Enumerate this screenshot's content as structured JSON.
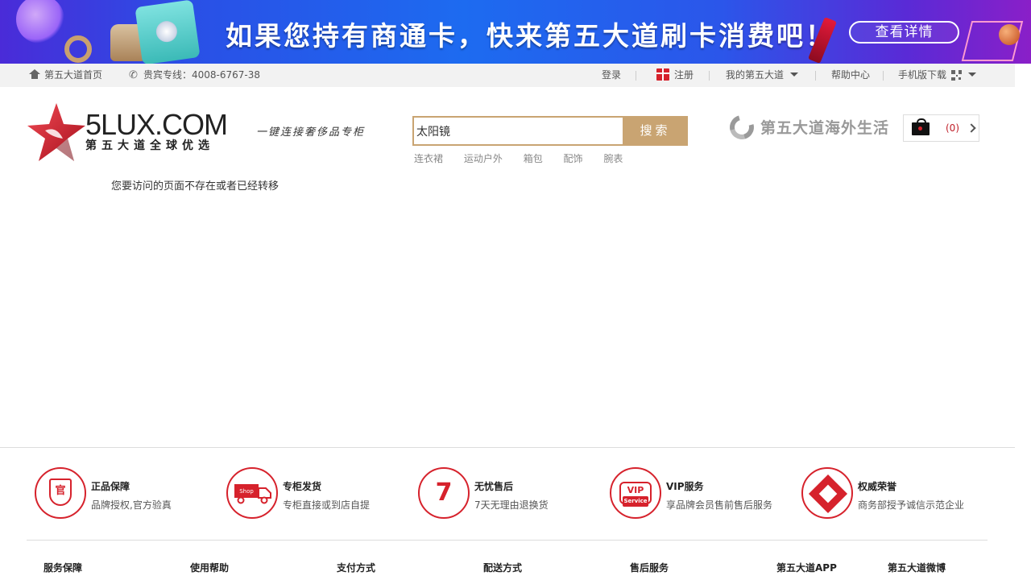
{
  "banner": {
    "headline": "如果您持有商通卡，快来第五大道刷卡消费吧！",
    "button_label": "查看详情"
  },
  "topbar": {
    "home_label": "第五大道首页",
    "hotline_label": "贵宾专线：4008-6767-38",
    "login_label": "登录",
    "register_label": "注册",
    "my_account_label": "我的第五大道",
    "help_label": "帮助中心",
    "mobile_label": "手机版下载"
  },
  "header": {
    "logo_text": "5LUX.COM",
    "logo_subtitle": "第五大道全球优选",
    "slogan": "一键连接奢侈品专柜",
    "search": {
      "value": "太阳镜",
      "button_label": "搜索"
    },
    "hot_words": [
      "连衣裙",
      "运动户外",
      "箱包",
      "配饰",
      "腕表"
    ],
    "overseas_label": "第五大道海外生活",
    "cart_count": "(0)"
  },
  "main": {
    "message": "您要访问的页面不存在或者已经转移"
  },
  "footer": {
    "services": [
      {
        "title": "正品保障",
        "desc": "品牌授权,官方验真",
        "icon": "shield-icon",
        "glyph": "官"
      },
      {
        "title": "专柜发货",
        "desc": "专柜直接或到店自提",
        "icon": "truck-icon",
        "glyph": "Shop"
      },
      {
        "title": "无忧售后",
        "desc": "7天无理由退换货",
        "icon": "seven-day-icon",
        "glyph": "7"
      },
      {
        "title": "VIP服务",
        "desc": "享品牌会员售前售后服务",
        "icon": "vip-icon",
        "glyph": "VIP",
        "glyph_sub": "Service"
      },
      {
        "title": "权威荣誉",
        "desc": "商务部授予诚信示范企业",
        "icon": "honor-icon"
      }
    ],
    "columns": [
      "服务保障",
      "使用帮助",
      "支付方式",
      "配送方式",
      "售后服务",
      "第五大道APP",
      "第五大道微博"
    ]
  },
  "colors": {
    "accent": "#c9a472",
    "brand_red": "#d6222c"
  }
}
